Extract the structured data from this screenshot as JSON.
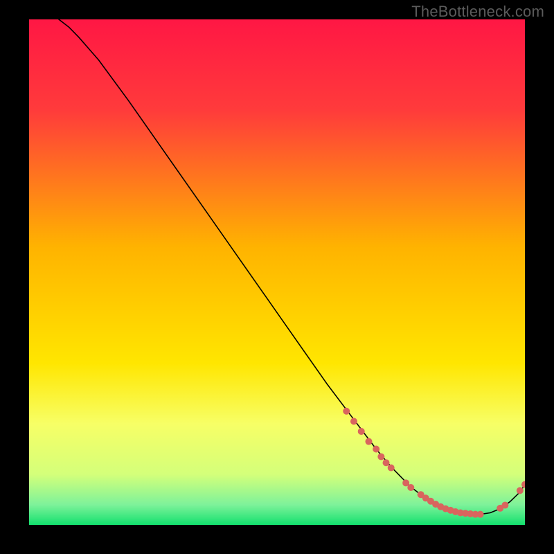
{
  "watermark": "TheBottleneck.com",
  "colors": {
    "curve": "#000000",
    "marker": "#d9655e",
    "gradient": [
      "#ff1744",
      "#ff3b3b",
      "#ffb300",
      "#ffe600",
      "#f7ff66",
      "#d4ff7a",
      "#7ef29a",
      "#13e06e"
    ]
  },
  "chart_data": {
    "type": "line",
    "title": "",
    "xlabel": "",
    "ylabel": "",
    "xlim": [
      0,
      100
    ],
    "ylim": [
      0,
      100
    ],
    "note": "Axes are unlabeled in source; values are normalized percentages read from pixel positions.",
    "series": [
      {
        "name": "curve",
        "x": [
          6,
          8,
          10,
          14,
          20,
          30,
          40,
          50,
          60,
          65,
          70,
          73,
          75,
          77,
          79,
          81,
          83,
          85,
          87,
          89,
          91,
          93,
          95,
          97,
          99,
          100
        ],
        "y": [
          100,
          98.5,
          96.5,
          92,
          84,
          70,
          56,
          42,
          28,
          21.5,
          15,
          11.5,
          9.5,
          7.5,
          6,
          4.8,
          3.8,
          3,
          2.5,
          2.2,
          2.1,
          2.4,
          3.2,
          4.6,
          6.5,
          8
        ]
      }
    ],
    "markers": {
      "name": "highlighted-points",
      "points": [
        {
          "x": 64,
          "y": 22.5
        },
        {
          "x": 65.5,
          "y": 20.5
        },
        {
          "x": 67,
          "y": 18.5
        },
        {
          "x": 68.5,
          "y": 16.5
        },
        {
          "x": 70,
          "y": 15
        },
        {
          "x": 71,
          "y": 13.5
        },
        {
          "x": 72,
          "y": 12.3
        },
        {
          "x": 73,
          "y": 11.3
        },
        {
          "x": 76,
          "y": 8.3
        },
        {
          "x": 77,
          "y": 7.4
        },
        {
          "x": 79,
          "y": 6
        },
        {
          "x": 80,
          "y": 5.3
        },
        {
          "x": 81,
          "y": 4.7
        },
        {
          "x": 82,
          "y": 4.1
        },
        {
          "x": 83,
          "y": 3.6
        },
        {
          "x": 84,
          "y": 3.2
        },
        {
          "x": 85,
          "y": 2.9
        },
        {
          "x": 86,
          "y": 2.6
        },
        {
          "x": 87,
          "y": 2.4
        },
        {
          "x": 88,
          "y": 2.3
        },
        {
          "x": 89,
          "y": 2.2
        },
        {
          "x": 90,
          "y": 2.1
        },
        {
          "x": 91,
          "y": 2.1
        },
        {
          "x": 95,
          "y": 3.3
        },
        {
          "x": 96,
          "y": 3.9
        },
        {
          "x": 99,
          "y": 6.8
        },
        {
          "x": 100,
          "y": 8.0
        }
      ]
    }
  }
}
